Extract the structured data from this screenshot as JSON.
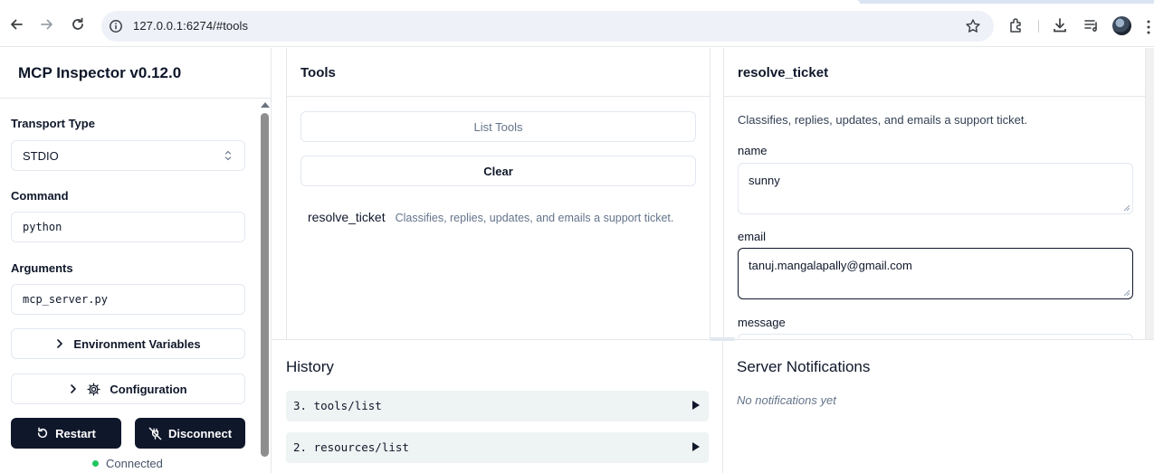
{
  "browser": {
    "url": "127.0.0.1:6274/#tools"
  },
  "sidebar": {
    "title": "MCP Inspector v0.12.0",
    "transport_label": "Transport Type",
    "transport_value": "STDIO",
    "command_label": "Command",
    "command_value": "python",
    "arguments_label": "Arguments",
    "arguments_value": "mcp_server.py",
    "env_button": "Environment Variables",
    "config_button": "Configuration",
    "restart_button": "Restart",
    "disconnect_button": "Disconnect",
    "status_text": "Connected",
    "status_color": "#22c55e"
  },
  "tools": {
    "title": "Tools",
    "list_button": "List Tools",
    "clear_button": "Clear",
    "items": [
      {
        "name": "resolve_ticket",
        "description": "Classifies, replies, updates, and emails a support ticket."
      }
    ]
  },
  "detail": {
    "title": "resolve_ticket",
    "description": "Classifies, replies, updates, and emails a support ticket.",
    "fields": [
      {
        "label": "name",
        "value": "sunny"
      },
      {
        "label": "email",
        "value": "tanuj.mangalapally@gmail.com"
      },
      {
        "label": "message",
        "value": ""
      }
    ]
  },
  "history": {
    "title": "History",
    "items": [
      {
        "label": "3. tools/list"
      },
      {
        "label": "2. resources/list"
      }
    ]
  },
  "notifications": {
    "title": "Server Notifications",
    "empty_text": "No notifications yet"
  },
  "colors": {
    "primary_dark": "#0f172a",
    "border": "#e2e8f0",
    "history_bg": "#eef3f3"
  },
  "icons": [
    "back-icon",
    "forward-icon",
    "reload-icon",
    "site-info-icon",
    "star-icon",
    "extensions-icon",
    "download-icon",
    "reading-list-icon",
    "chevron-right-icon",
    "gear-icon",
    "restart-icon",
    "disconnect-icon",
    "play-arrow-icon"
  ]
}
